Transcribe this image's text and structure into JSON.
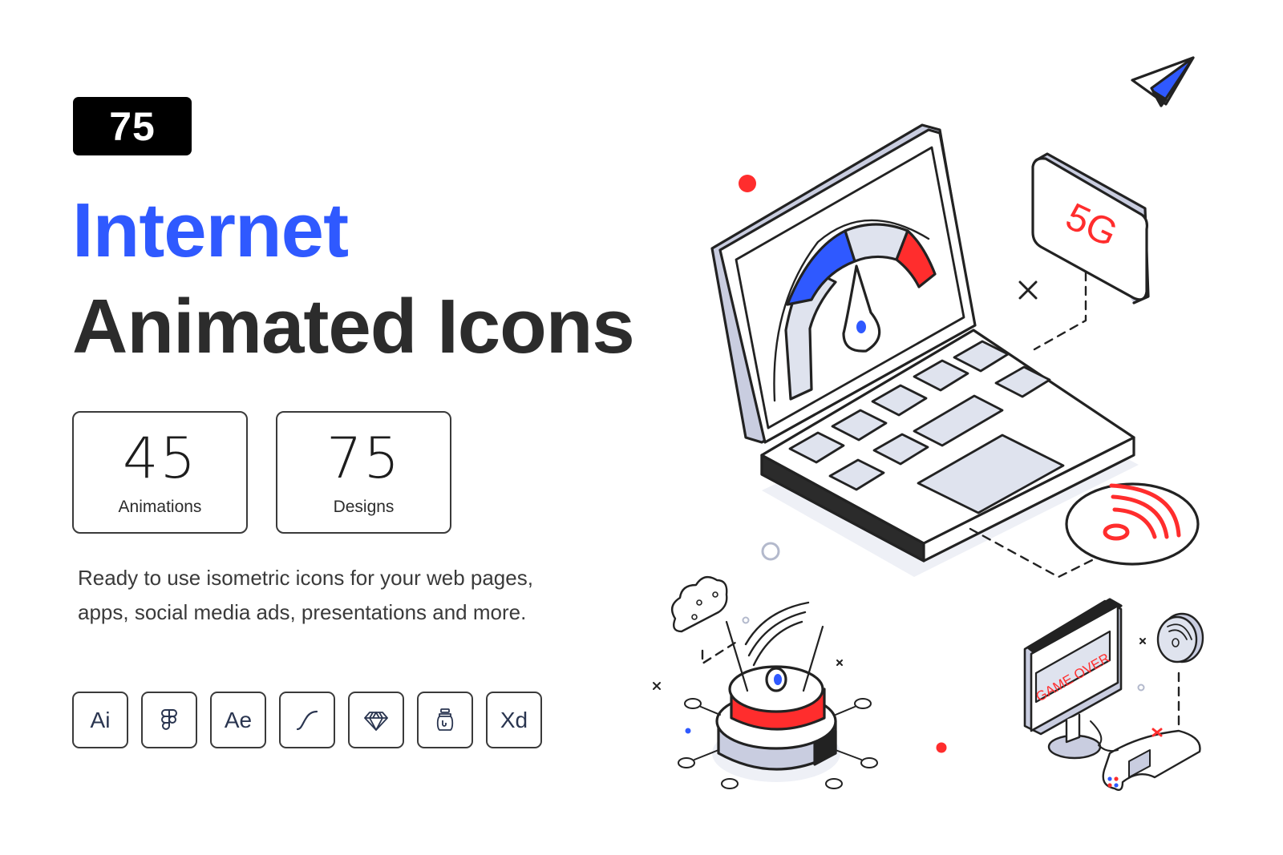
{
  "badge": {
    "count": "75"
  },
  "title": {
    "line1": "Internet",
    "line2": "Animated Icons"
  },
  "stats": [
    {
      "value": "45",
      "label": "Animations"
    },
    {
      "value": "75",
      "label": "Designs"
    }
  ],
  "description": "Ready to use isometric icons for your web pages, apps, social media ads, presentations and more.",
  "tools": [
    {
      "label": "Ai",
      "icon": "illustrator-icon"
    },
    {
      "label": "",
      "icon": "figma-icon"
    },
    {
      "label": "Ae",
      "icon": "after-effects-icon"
    },
    {
      "label": "",
      "icon": "bezier-curve-icon"
    },
    {
      "label": "",
      "icon": "sketch-diamond-icon"
    },
    {
      "label": "",
      "icon": "lottie-jar-icon"
    },
    {
      "label": "Xd",
      "icon": "adobe-xd-icon"
    }
  ],
  "illustration": {
    "badge_5g": "5G",
    "monitor_text": "GAME OVER"
  },
  "colors": {
    "accent_blue": "#2f59ff",
    "accent_red": "#ff2d2d",
    "outline": "#222222",
    "fill_light": "#dfe3ee",
    "fill_side": "#c9cde0"
  }
}
